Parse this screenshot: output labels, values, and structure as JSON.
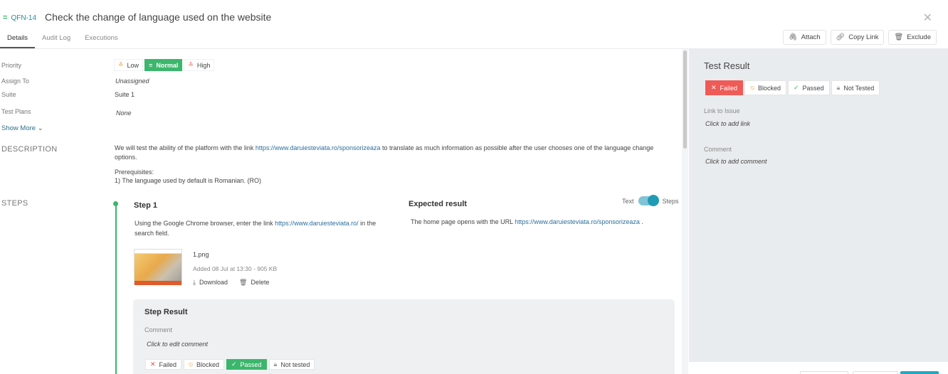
{
  "header": {
    "issue_key": "QFN-14",
    "issue_icon": "equals-icon",
    "title": "Check the change of language used on the website",
    "close_icon": "close-icon"
  },
  "tabs": [
    {
      "label": "Details",
      "active": true
    },
    {
      "label": "Audit Log",
      "active": false
    },
    {
      "label": "Executions",
      "active": false
    }
  ],
  "actions": {
    "attach": "Attach",
    "copy_link": "Copy Link",
    "exclude": "Exclude"
  },
  "fields": {
    "priority_label": "Priority",
    "priority_options": {
      "low": "Low",
      "normal": "Normal",
      "high": "High"
    },
    "priority_selected": "Normal",
    "assign_label": "Assign To",
    "assign_value": "Unassigned",
    "suite_label": "Suite",
    "suite_value": "Suite 1",
    "test_plans_label": "Test Plans",
    "test_plans_value": "None",
    "show_more": "Show More"
  },
  "description": {
    "heading": "DESCRIPTION",
    "text_before": "We will test the ability of the platform with the link ",
    "link": "https://www.daruiesteviata.ro/sponsorizeaza",
    "text_after": " to translate as much information as possible after the user chooses one of the language change options.",
    "prereq_title": "Prerequisites:",
    "prereq_item": "1) The language used by default is Romanian. (RO)"
  },
  "steps": {
    "heading": "STEPS",
    "toggle_text": "Text",
    "toggle_steps": "Steps",
    "step_title": "Step 1",
    "step_text_before": "Using the Google Chrome browser, enter the link ",
    "step_link": "https://www.daruiesteviata.ro/",
    "step_text_after": " in the search field.",
    "expected_title": "Expected result",
    "expected_before": "The home page opens with the URL ",
    "expected_link": "https://www.daruiesteviata.ro/sponsorizeaza",
    "expected_after": " .",
    "attachment": {
      "name": "1.png",
      "meta": "Added 08 Jul at 13:30 - 905 KB",
      "download": "Download",
      "delete": "Delete"
    },
    "step_result": {
      "title": "Step Result",
      "comment_label": "Comment",
      "comment_placeholder": "Click to edit comment",
      "buttons": {
        "failed": "Failed",
        "blocked": "Blocked",
        "passed": "Passed",
        "not_tested": "Not tested"
      },
      "selected": "Passed"
    }
  },
  "test_result": {
    "title": "Test Result",
    "buttons": {
      "failed": "Failed",
      "blocked": "Blocked",
      "passed": "Passed",
      "not_tested": "Not Tested"
    },
    "selected": "Failed",
    "link_label": "Link to Issue",
    "link_placeholder": "Click to add link",
    "comment_label": "Comment",
    "comment_placeholder": "Click to add comment"
  },
  "colors": {
    "green": "#3cb66c",
    "red": "#ef5b57",
    "teal": "#1f9bb5",
    "link": "#2d6f9c"
  }
}
